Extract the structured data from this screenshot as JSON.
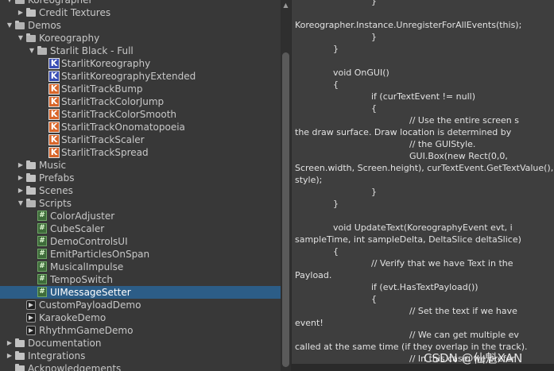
{
  "tree": [
    {
      "label": "Koreographer",
      "depth": 0,
      "kind": "folder-open",
      "arrow": "down"
    },
    {
      "label": "Credit Textures",
      "depth": 1,
      "kind": "folder",
      "arrow": "right"
    },
    {
      "label": "Demos",
      "depth": 0,
      "kind": "folder-open",
      "arrow": "down"
    },
    {
      "label": "Koreography",
      "depth": 1,
      "kind": "folder-open",
      "arrow": "down"
    },
    {
      "label": "Starlit Black - Full",
      "depth": 2,
      "kind": "folder-open",
      "arrow": "down"
    },
    {
      "label": "StarlitKoreography",
      "depth": 3,
      "kind": "koreo-blue"
    },
    {
      "label": "StarlitKoreographyExtended",
      "depth": 3,
      "kind": "koreo-blue"
    },
    {
      "label": "StarlitTrackBump",
      "depth": 3,
      "kind": "koreo-orange"
    },
    {
      "label": "StarlitTrackColorJump",
      "depth": 3,
      "kind": "koreo-orange"
    },
    {
      "label": "StarlitTrackColorSmooth",
      "depth": 3,
      "kind": "koreo-orange"
    },
    {
      "label": "StarlitTrackOnomatopoeia",
      "depth": 3,
      "kind": "koreo-orange"
    },
    {
      "label": "StarlitTrackScaler",
      "depth": 3,
      "kind": "koreo-orange"
    },
    {
      "label": "StarlitTrackSpread",
      "depth": 3,
      "kind": "koreo-orange"
    },
    {
      "label": "Music",
      "depth": 1,
      "kind": "folder",
      "arrow": "right"
    },
    {
      "label": "Prefabs",
      "depth": 1,
      "kind": "folder",
      "arrow": "right"
    },
    {
      "label": "Scenes",
      "depth": 1,
      "kind": "folder",
      "arrow": "right"
    },
    {
      "label": "Scripts",
      "depth": 1,
      "kind": "folder-open",
      "arrow": "down"
    },
    {
      "label": "ColorAdjuster",
      "depth": 2,
      "kind": "script"
    },
    {
      "label": "CubeScaler",
      "depth": 2,
      "kind": "script"
    },
    {
      "label": "DemoControlsUI",
      "depth": 2,
      "kind": "script"
    },
    {
      "label": "EmitParticlesOnSpan",
      "depth": 2,
      "kind": "script"
    },
    {
      "label": "MusicalImpulse",
      "depth": 2,
      "kind": "script"
    },
    {
      "label": "TempoSwitch",
      "depth": 2,
      "kind": "script"
    },
    {
      "label": "UIMessageSetter",
      "depth": 2,
      "kind": "script",
      "selected": true
    },
    {
      "label": "CustomPayloadDemo",
      "depth": 1,
      "kind": "scene"
    },
    {
      "label": "KaraokeDemo",
      "depth": 1,
      "kind": "scene"
    },
    {
      "label": "RhythmGameDemo",
      "depth": 1,
      "kind": "scene"
    },
    {
      "label": "Documentation",
      "depth": 0,
      "kind": "folder",
      "arrow": "right"
    },
    {
      "label": "Integrations",
      "depth": 0,
      "kind": "folder",
      "arrow": "right"
    },
    {
      "label": "Acknowledgements",
      "depth": 0,
      "kind": "folder",
      "arrow": "none"
    }
  ],
  "code": [
    {
      "text": "}",
      "indent": 2
    },
    {
      "text": "",
      "indent": 0
    },
    {
      "text": "Koreographer.Instance.UnregisterForAllEvents(this);",
      "indent": 0
    },
    {
      "text": "}",
      "indent": 2
    },
    {
      "text": "}",
      "indent": 1
    },
    {
      "text": "",
      "indent": 0
    },
    {
      "text": "void OnGUI()",
      "indent": 1
    },
    {
      "text": "{",
      "indent": 1
    },
    {
      "text": "if (curTextEvent != null)",
      "indent": 2
    },
    {
      "text": "{",
      "indent": 2
    },
    {
      "text": "// Use the entire screen s",
      "indent": 3
    },
    {
      "text": "the draw surface. Draw location is determined by",
      "indent": 0
    },
    {
      "text": "//            the GUIStyle.",
      "indent": 3
    },
    {
      "text": "GUI.Box(new Rect(0,0,",
      "indent": 3
    },
    {
      "text": "Screen.width, Screen.height), curTextEvent.GetTextValue(),",
      "indent": 0
    },
    {
      "text": "style);",
      "indent": 0
    },
    {
      "text": "}",
      "indent": 2
    },
    {
      "text": "}",
      "indent": 1
    },
    {
      "text": "",
      "indent": 0
    },
    {
      "text": "void UpdateText(KoreographyEvent evt, i",
      "indent": 1
    },
    {
      "text": "sampleTime, int sampleDelta, DeltaSlice deltaSlice)",
      "indent": 0
    },
    {
      "text": "{",
      "indent": 1
    },
    {
      "text": "// Verify that we have Text in the",
      "indent": 2
    },
    {
      "text": "Payload.",
      "indent": 0
    },
    {
      "text": "if (evt.HasTextPayload())",
      "indent": 2
    },
    {
      "text": "{",
      "indent": 2
    },
    {
      "text": "// Set the text if we have",
      "indent": 3
    },
    {
      "text": "event!",
      "indent": 0
    },
    {
      "text": "// We can get multiple ev",
      "indent": 3
    },
    {
      "text": "called at the same time (if they overlap in the track).",
      "indent": 0
    },
    {
      "text": "// In this case, we prefer",
      "indent": 3
    }
  ],
  "watermark": "CSDN @仙魁XAN",
  "colors": {
    "selection": "#2c5d87",
    "koreography_asset": "#3a4fb6",
    "track_asset": "#d9662a",
    "script_icon": "#3e6b3a"
  }
}
